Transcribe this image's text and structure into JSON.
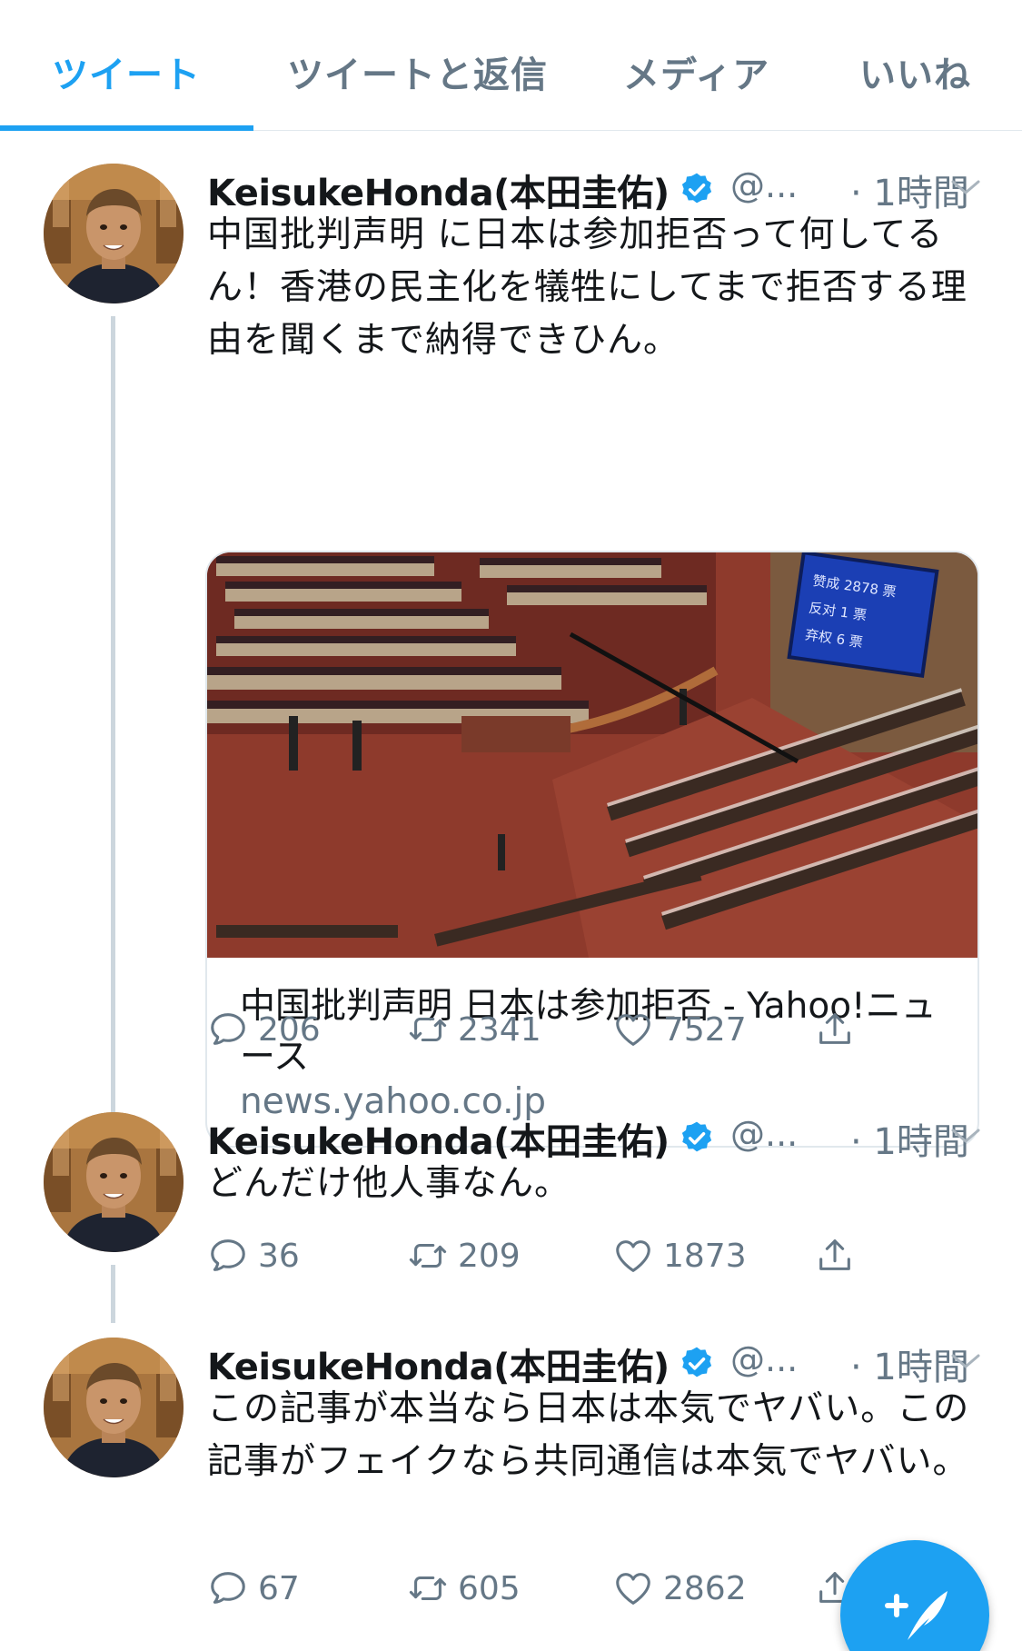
{
  "tabs": [
    {
      "label": "ツイート",
      "active": true
    },
    {
      "label": "ツイートと返信",
      "active": false
    },
    {
      "label": "メディア",
      "active": false
    },
    {
      "label": "いいね",
      "active": false
    }
  ],
  "tweets": [
    {
      "name": "KeisukeHonda(本田圭佑)",
      "handle": "@...",
      "time": "· 1時間",
      "text": "中国批判声明 に日本は参加拒否って何してるん！香港の民主化を犠牲にしてまで拒否する理由を聞くまで納得できひん。",
      "card": {
        "title": "中国批判声明 日本は参加拒否 - Yahoo!ニュース",
        "domain": "news.yahoo.co.jp",
        "screen": {
          "line1": "赞成 2878 票",
          "line2": "反对 1 票",
          "line3": "弃权 6 票"
        }
      },
      "replies": "206",
      "retweets": "2341",
      "likes": "7527"
    },
    {
      "name": "KeisukeHonda(本田圭佑)",
      "handle": "@...",
      "time": "· 1時間",
      "text": "どんだけ他人事なん。",
      "replies": "36",
      "retweets": "209",
      "likes": "1873"
    },
    {
      "name": "KeisukeHonda(本田圭佑)",
      "handle": "@...",
      "time": "· 1時間",
      "text": "この記事が本当なら日本は本気でヤバい。この記事がフェイクなら共同通信は本気でヤバい。",
      "replies": "67",
      "retweets": "605",
      "likes": "2862"
    }
  ],
  "icons": {
    "reply": "reply-icon",
    "retweet": "retweet-icon",
    "like": "heart-icon",
    "share": "share-icon",
    "verified": "verified-badge-icon",
    "compose": "compose-tweet-icon"
  },
  "colors": {
    "accent": "#1da1f2",
    "text": "#14171a",
    "secondary": "#657786",
    "border": "#e1e8ed"
  }
}
